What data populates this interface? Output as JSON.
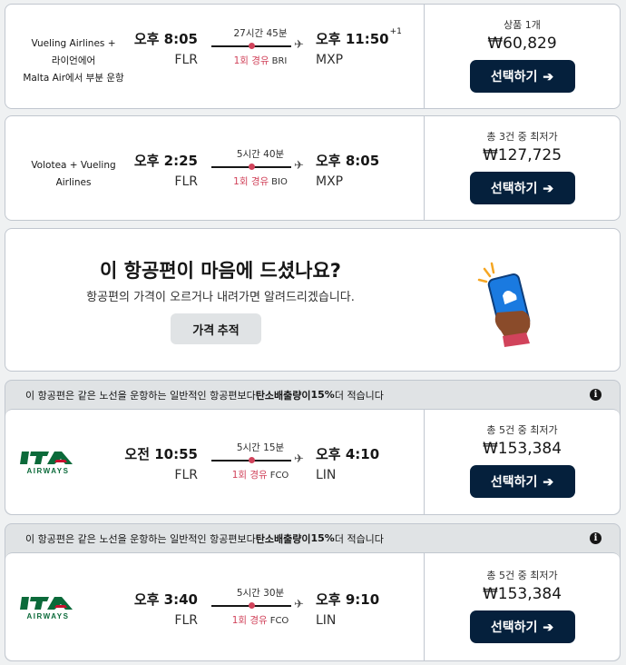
{
  "flights": [
    {
      "airline": [
        "Vueling Airlines +",
        "라이언에어",
        "Malta Air에서 부분 운항"
      ],
      "dep_time": "오후 8:05",
      "dep_code": "FLR",
      "duration": "27시간 45분",
      "stops": "1회 경유",
      "via": "BRI",
      "arr_time": "오후 11:50",
      "arr_offset": "+1",
      "arr_code": "MXP",
      "price_label": "상품 1개",
      "price": "₩60,829",
      "button": "선택하기"
    },
    {
      "airline": [
        "Volotea + Vueling",
        "Airlines"
      ],
      "dep_time": "오후 2:25",
      "dep_code": "FLR",
      "duration": "5시간 40분",
      "stops": "1회 경유",
      "via": "BIO",
      "arr_time": "오후 8:05",
      "arr_offset": "",
      "arr_code": "MXP",
      "price_label": "총 3건 중 최저가",
      "price": "₩127,725",
      "button": "선택하기"
    },
    {
      "airline_logo": "ITA",
      "logo_sub": "AIRWAYS",
      "notice": [
        "이 항공편은 같은 노선을 운항하는 일반적인 항공편보다 ",
        "탄소배출량이",
        " 15%",
        " 더 적습니다"
      ],
      "dep_time": "오전 10:55",
      "dep_code": "FLR",
      "duration": "5시간 15분",
      "stops": "1회 경유",
      "via": "FCO",
      "arr_time": "오후 4:10",
      "arr_code": "LIN",
      "price_label": "총 5건 중 최저가",
      "price": "₩153,384",
      "button": "선택하기"
    },
    {
      "airline_logo": "ITA",
      "logo_sub": "AIRWAYS",
      "notice": [
        "이 항공편은 같은 노선을 운항하는 일반적인 항공편보다 ",
        "탄소배출량이",
        " 15%",
        " 더 적습니다"
      ],
      "dep_time": "오후 3:40",
      "dep_code": "FLR",
      "duration": "5시간 30분",
      "stops": "1회 경유",
      "via": "FCO",
      "arr_time": "오후 9:10",
      "arr_code": "LIN",
      "price_label": "총 5건 중 최저가",
      "price": "₩153,384",
      "button": "선택하기"
    }
  ],
  "tracker": {
    "title": "이 항공편이 마음에 드셨나요?",
    "subtitle": "항공편의 가격이 오르거나 내려가면 알려드리겠습니다.",
    "button": "가격 추적"
  },
  "colors": {
    "accent_dark": "#05203c",
    "stop_pink": "#d1435b",
    "ita_green": "#0b6a3a",
    "ita_red": "#c8102e"
  },
  "icons": {
    "plane": "plane-icon",
    "arrow": "arrow-right-icon",
    "info": "info-icon",
    "illustration": "hand-holding-phone-illustration"
  }
}
